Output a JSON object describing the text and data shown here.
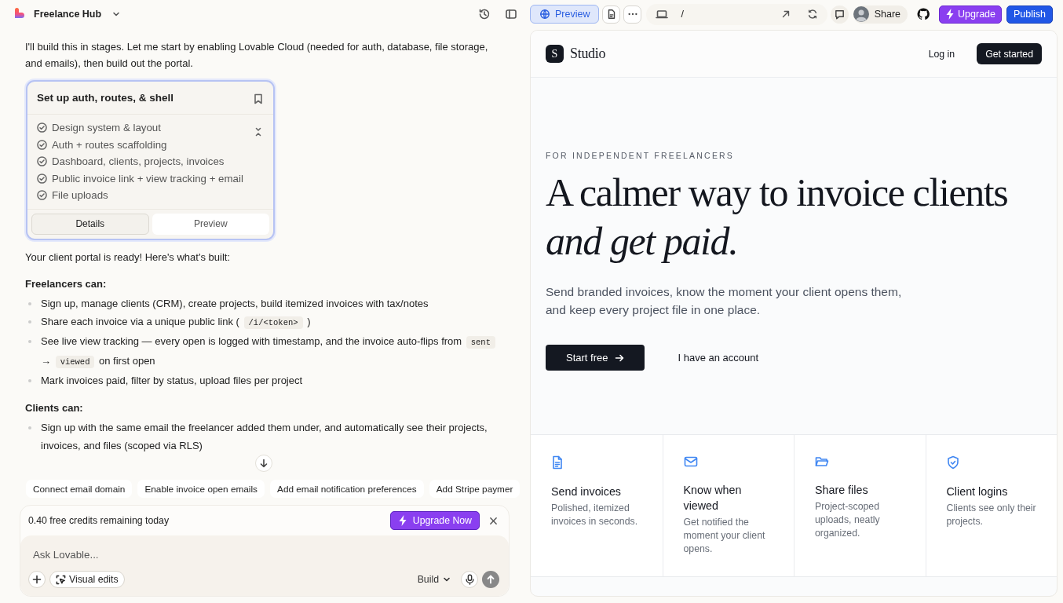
{
  "project": {
    "name": "Freelance Hub"
  },
  "toolbar": {
    "preview_tab": {
      "label": "Preview",
      "selected": true
    },
    "url_path": "/",
    "share_label": "Share",
    "upgrade_label": "Upgrade",
    "publish_label": "Publish"
  },
  "chat": {
    "intro": "I'll build this in stages. Let me start by enabling Lovable Cloud (needed for auth, database, file storage, and emails), then build out the portal.",
    "task": {
      "title": "Set up auth, routes, & shell",
      "steps": [
        {
          "label": "Design system & layout",
          "done": true
        },
        {
          "label": "Auth + routes scaffolding",
          "done": true
        },
        {
          "label": "Dashboard, clients, projects, invoices",
          "done": true
        },
        {
          "label": "Public invoice link + view tracking + email",
          "done": true
        },
        {
          "label": "File uploads",
          "done": true
        }
      ],
      "tabs": [
        {
          "label": "Details",
          "selected": true
        },
        {
          "label": "Preview",
          "selected": false
        }
      ]
    },
    "summary": "Your client portal is ready! Here's what's built:",
    "sections": [
      {
        "heading": "Freelancers can:",
        "bullets": [
          [
            {
              "text": "Sign up, manage clients (CRM), create projects, build itemized invoices with tax/notes"
            }
          ],
          [
            {
              "text": "Share each invoice via a unique public link ( "
            },
            {
              "code": "/i/<token>"
            },
            {
              "text": " )"
            }
          ],
          [
            {
              "text": "See live view tracking — every open is logged with timestamp, and the invoice auto-flips from "
            },
            {
              "code": "sent"
            },
            {
              "text": " → "
            },
            {
              "code": "viewed"
            },
            {
              "text": " on first open"
            }
          ],
          [
            {
              "text": "Mark invoices paid, filter by status, upload files per project"
            }
          ]
        ]
      },
      {
        "heading": "Clients can:",
        "bullets": [
          [
            {
              "text": "Sign up with the same email the freelancer added them under, and automatically see their projects, invoices, and files (scoped via RLS)"
            }
          ]
        ]
      }
    ],
    "suggestions": [
      "Connect email domain",
      "Enable invoice open emails",
      "Add email notification preferences",
      "Add Stripe paymer"
    ],
    "credits": {
      "text": "0.40 free credits remaining today",
      "button": "Upgrade Now"
    },
    "composer": {
      "placeholder": "Ask Lovable...",
      "visual_edits": "Visual edits",
      "mode": "Build"
    }
  },
  "preview": {
    "brand_mark": "S",
    "brand_name": "Studio",
    "login": "Log in",
    "get_started": "Get started",
    "eyebrow": "FOR INDEPENDENT FREELANCERS",
    "headline": "A calmer way to invoice clients",
    "headline_italic": "and get paid.",
    "subtitle": "Send branded invoices, know the moment your client opens them, and keep every project file in one place.",
    "primary": "Start free",
    "secondary": "I have an account",
    "features": [
      {
        "kind": "document",
        "title": "Send invoices",
        "text": "Polished, itemized invoices in seconds."
      },
      {
        "kind": "mail",
        "title": "Know when viewed",
        "text": "Get notified the moment your client opens."
      },
      {
        "kind": "folder",
        "title": "Share files",
        "text": "Project-scoped uploads, neatly organized."
      },
      {
        "kind": "shield",
        "title": "Client logins",
        "text": "Clients see only their projects."
      }
    ]
  }
}
